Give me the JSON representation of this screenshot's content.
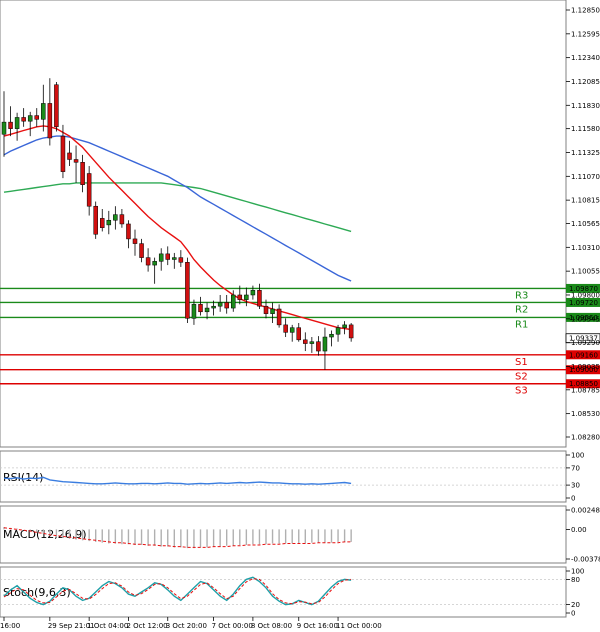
{
  "chart_data": {
    "type": "candlestick",
    "main": {
      "price_axis_ticks": [
        "1.12850",
        "1.12595",
        "1.12340",
        "1.12085",
        "1.11830",
        "1.11580",
        "1.11325",
        "1.11070",
        "1.10815",
        "1.10565",
        "1.10310",
        "1.10055",
        "1.09800",
        "1.09545",
        "1.09290",
        "1.09035",
        "1.08785",
        "1.08530",
        "1.08280"
      ],
      "ylim": [
        1.0828,
        1.1285
      ],
      "x_ticks": [
        "16:00",
        "29 Sep 21:01",
        "1 Oct 04:00",
        "2 Oct 12:00",
        "3 Oct 20:00",
        "7 Oct 00:00",
        "8 Oct 08:00",
        "9 Oct 16:00",
        "11 Oct 00:00"
      ],
      "current_price": "1.09337",
      "levels": [
        {
          "name": "R3",
          "value": "1.09870",
          "color": "#1a8a1a"
        },
        {
          "name": "R2",
          "value": "1.09720",
          "color": "#1a8a1a"
        },
        {
          "name": "R1",
          "value": "1.09560",
          "color": "#1a8a1a"
        },
        {
          "name": "S1",
          "value": "1.09160",
          "color": "#dd0000"
        },
        {
          "name": "S2",
          "value": "1.09000",
          "color": "#dd0000"
        },
        {
          "name": "S3",
          "value": "1.08850",
          "color": "#dd0000"
        }
      ],
      "candles_ohlc": [
        [
          1.1152,
          1.1198,
          1.1128,
          1.1165
        ],
        [
          1.1165,
          1.1182,
          1.115,
          1.1158
        ],
        [
          1.1158,
          1.1175,
          1.1145,
          1.117
        ],
        [
          1.117,
          1.118,
          1.116,
          1.1166
        ],
        [
          1.1166,
          1.1176,
          1.115,
          1.1172
        ],
        [
          1.1172,
          1.118,
          1.116,
          1.1168
        ],
        [
          1.1168,
          1.1205,
          1.1155,
          1.1185
        ],
        [
          1.1185,
          1.1212,
          1.114,
          1.1148
        ],
        [
          1.1205,
          1.1208,
          1.1155,
          1.116
        ],
        [
          1.115,
          1.1162,
          1.1105,
          1.1112
        ],
        [
          1.1132,
          1.1145,
          1.1118,
          1.1125
        ],
        [
          1.1125,
          1.114,
          1.11,
          1.1122
        ],
        [
          1.1122,
          1.113,
          1.109,
          1.1098
        ],
        [
          1.111,
          1.1118,
          1.1065,
          1.1075
        ],
        [
          1.1075,
          1.108,
          1.104,
          1.1045
        ],
        [
          1.1062,
          1.1072,
          1.1048,
          1.1052
        ],
        [
          1.1055,
          1.107,
          1.1045,
          1.106
        ],
        [
          1.106,
          1.1075,
          1.105,
          1.1066
        ],
        [
          1.1066,
          1.1072,
          1.1052,
          1.1056
        ],
        [
          1.1056,
          1.106,
          1.103,
          1.104
        ],
        [
          1.104,
          1.105,
          1.1022,
          1.1035
        ],
        [
          1.1035,
          1.104,
          1.1015,
          1.102
        ],
        [
          1.102,
          1.103,
          1.1005,
          1.1012
        ],
        [
          1.1012,
          1.102,
          1.0992,
          1.1016
        ],
        [
          1.1016,
          1.103,
          1.1006,
          1.1024
        ],
        [
          1.1024,
          1.1032,
          1.1012,
          1.1018
        ],
        [
          1.1018,
          1.1025,
          1.1008,
          1.102
        ],
        [
          1.102,
          1.1028,
          1.101,
          1.1015
        ],
        [
          1.1015,
          1.102,
          1.095,
          1.0955
        ],
        [
          1.0955,
          1.0975,
          1.0948,
          1.097
        ],
        [
          1.097,
          1.0978,
          1.0958,
          1.0962
        ],
        [
          1.0962,
          1.0972,
          1.0954,
          1.0966
        ],
        [
          1.0966,
          1.0974,
          1.0958,
          1.0968
        ],
        [
          1.0968,
          1.098,
          1.0962,
          1.0972
        ],
        [
          1.0972,
          1.098,
          1.096,
          1.0966
        ],
        [
          1.0966,
          1.0985,
          1.0962,
          1.098
        ],
        [
          1.098,
          1.099,
          1.097,
          1.0975
        ],
        [
          1.0975,
          1.0988,
          1.0968,
          1.098
        ],
        [
          1.098,
          1.099,
          1.0975,
          1.0985
        ],
        [
          1.0985,
          1.0992,
          1.0965,
          1.0968
        ],
        [
          1.0968,
          1.0975,
          1.0955,
          1.096
        ],
        [
          1.096,
          1.0972,
          1.095,
          1.0965
        ],
        [
          1.0965,
          1.097,
          1.0945,
          1.0948
        ],
        [
          1.0948,
          1.0955,
          1.0935,
          1.094
        ],
        [
          1.094,
          1.0948,
          1.093,
          1.0945
        ],
        [
          1.0945,
          1.095,
          1.093,
          1.0932
        ],
        [
          1.0932,
          1.094,
          1.092,
          1.0928
        ],
        [
          1.0928,
          1.0935,
          1.0918,
          1.093
        ],
        [
          1.093,
          1.0936,
          1.0915,
          1.092
        ],
        [
          1.092,
          1.0945,
          1.09,
          1.0935
        ],
        [
          1.0935,
          1.0942,
          1.0925,
          1.0938
        ],
        [
          1.0938,
          1.0948,
          1.093,
          1.0945
        ],
        [
          1.0945,
          1.0952,
          1.0938,
          1.0948
        ],
        [
          1.0948,
          1.095,
          1.093,
          1.0934
        ]
      ],
      "ma_red": [
        1.115,
        1.1152,
        1.1154,
        1.1156,
        1.1158,
        1.116,
        1.1161,
        1.116,
        1.1158,
        1.1154,
        1.115,
        1.1144,
        1.1138,
        1.113,
        1.1122,
        1.1114,
        1.1106,
        1.1099,
        1.1092,
        1.1085,
        1.1078,
        1.1071,
        1.1064,
        1.1058,
        1.1052,
        1.1047,
        1.1042,
        1.1037,
        1.1028,
        1.1018,
        1.101,
        1.1003,
        1.0996,
        1.099,
        1.0985,
        1.098,
        1.0976,
        1.0973,
        1.0971,
        1.0969,
        1.0967,
        1.0965,
        1.0963,
        1.0961,
        1.0959,
        1.0957,
        1.0955,
        1.0953,
        1.0951,
        1.0949,
        1.0947,
        1.0945,
        1.0944,
        1.0943
      ],
      "ma_blue": [
        1.113,
        1.1134,
        1.1137,
        1.114,
        1.1143,
        1.1146,
        1.1148,
        1.1149,
        1.115,
        1.115,
        1.1149,
        1.1147,
        1.1145,
        1.1143,
        1.114,
        1.1137,
        1.1134,
        1.1131,
        1.1128,
        1.1125,
        1.1122,
        1.1119,
        1.1116,
        1.1113,
        1.111,
        1.1107,
        1.1103,
        1.1099,
        1.1095,
        1.109,
        1.1085,
        1.1081,
        1.1077,
        1.1073,
        1.1069,
        1.1065,
        1.1061,
        1.1057,
        1.1053,
        1.1049,
        1.1045,
        1.1041,
        1.1037,
        1.1033,
        1.1029,
        1.1025,
        1.1021,
        1.1017,
        1.1013,
        1.1009,
        1.1005,
        1.1001,
        1.0998,
        1.0995
      ],
      "ma_green": [
        1.109,
        1.1091,
        1.1092,
        1.1093,
        1.1094,
        1.1095,
        1.1096,
        1.1097,
        1.1098,
        1.1099,
        1.1099,
        1.11,
        1.11,
        1.11,
        1.11,
        1.11,
        1.11,
        1.11,
        1.11,
        1.11,
        1.11,
        1.11,
        1.11,
        1.11,
        1.11,
        1.1099,
        1.1098,
        1.1097,
        1.1096,
        1.1095,
        1.1094,
        1.1092,
        1.109,
        1.1088,
        1.1086,
        1.1084,
        1.1082,
        1.108,
        1.1078,
        1.1076,
        1.1074,
        1.1072,
        1.107,
        1.1068,
        1.1066,
        1.1064,
        1.1062,
        1.106,
        1.1058,
        1.1056,
        1.1054,
        1.1052,
        1.105,
        1.1048
      ]
    },
    "rsi": {
      "title": "RSI(14)",
      "axis_ticks": [
        "100",
        "70",
        "30",
        "0"
      ],
      "ylim": [
        0,
        100
      ],
      "values": [
        46,
        45,
        47,
        44,
        46,
        45,
        48,
        42,
        40,
        38,
        37,
        36,
        35,
        34,
        33,
        33,
        34,
        35,
        34,
        33,
        33,
        34,
        34,
        33,
        34,
        35,
        34,
        34,
        32,
        33,
        34,
        33,
        34,
        35,
        34,
        35,
        36,
        35,
        36,
        37,
        36,
        35,
        35,
        34,
        33,
        33,
        32,
        33,
        32,
        33,
        34,
        35,
        36,
        34
      ]
    },
    "macd": {
      "title": "MACD(12,26,9)",
      "axis_ticks": [
        "0.00248",
        "0.00",
        "-0.003788"
      ],
      "ylim": [
        -0.003788,
        0.00248
      ],
      "histogram": [
        0.0003,
        0.0002,
        0.0001,
        0.0,
        -0.0002,
        -0.0004,
        -0.0006,
        -0.0008,
        -0.001,
        -0.0011,
        -0.0012,
        -0.0013,
        -0.0014,
        -0.0015,
        -0.0016,
        -0.0017,
        -0.0018,
        -0.0018,
        -0.0019,
        -0.0019,
        -0.002,
        -0.002,
        -0.0021,
        -0.0021,
        -0.0022,
        -0.0022,
        -0.0023,
        -0.0023,
        -0.0024,
        -0.0024,
        -0.0023,
        -0.0023,
        -0.0022,
        -0.0022,
        -0.0021,
        -0.0021,
        -0.002,
        -0.002,
        -0.0019,
        -0.0019,
        -0.0019,
        -0.0018,
        -0.0018,
        -0.0018,
        -0.0018,
        -0.0018,
        -0.0018,
        -0.0017,
        -0.0017,
        -0.0017,
        -0.0017,
        -0.0016,
        -0.0016,
        -0.0016
      ],
      "signal": [
        0.0002,
        0.0001,
        0.0,
        -0.0001,
        -0.0002,
        -0.0004,
        -0.0005,
        -0.0007,
        -0.0008,
        -0.0009,
        -0.001,
        -0.0011,
        -0.0012,
        -0.0013,
        -0.0014,
        -0.0015,
        -0.0016,
        -0.0017,
        -0.0017,
        -0.0018,
        -0.0019,
        -0.0019,
        -0.002,
        -0.002,
        -0.0021,
        -0.0021,
        -0.0022,
        -0.0022,
        -0.0023,
        -0.0023,
        -0.0023,
        -0.0023,
        -0.0022,
        -0.0022,
        -0.0022,
        -0.0021,
        -0.0021,
        -0.002,
        -0.002,
        -0.002,
        -0.0019,
        -0.0019,
        -0.0019,
        -0.0018,
        -0.0018,
        -0.0018,
        -0.0018,
        -0.0018,
        -0.0017,
        -0.0017,
        -0.0017,
        -0.0017,
        -0.0016,
        -0.0016
      ]
    },
    "stoch": {
      "title": "Stoch(9,6,3)",
      "axis_ticks": [
        "100",
        "80",
        "20",
        "0"
      ],
      "ylim": [
        0,
        100
      ],
      "k": [
        40,
        55,
        65,
        50,
        35,
        25,
        20,
        28,
        45,
        60,
        55,
        40,
        30,
        35,
        50,
        65,
        75,
        70,
        60,
        45,
        40,
        50,
        60,
        72,
        68,
        55,
        40,
        30,
        45,
        60,
        75,
        70,
        55,
        40,
        30,
        45,
        65,
        80,
        85,
        75,
        60,
        40,
        28,
        20,
        22,
        30,
        25,
        20,
        28,
        45,
        62,
        75,
        80,
        78
      ],
      "d": [
        38,
        48,
        58,
        55,
        42,
        30,
        24,
        25,
        38,
        52,
        56,
        46,
        35,
        33,
        44,
        58,
        70,
        72,
        64,
        50,
        42,
        46,
        56,
        68,
        70,
        60,
        46,
        34,
        40,
        54,
        68,
        72,
        60,
        46,
        34,
        40,
        58,
        74,
        82,
        80,
        66,
        46,
        32,
        24,
        22,
        27,
        26,
        22,
        25,
        38,
        55,
        70,
        78,
        80
      ]
    }
  }
}
